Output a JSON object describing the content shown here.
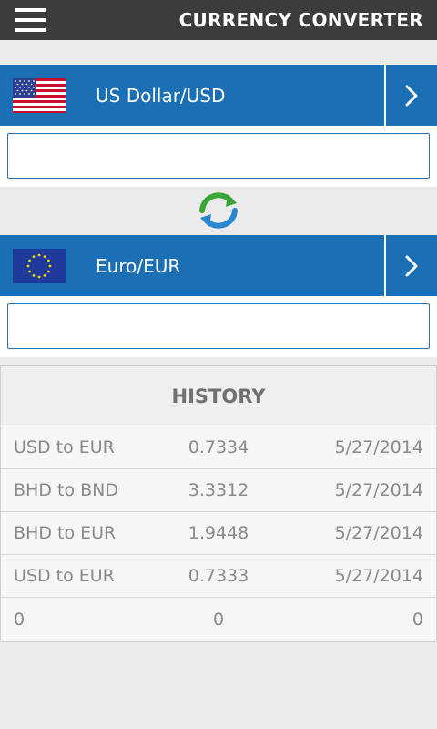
{
  "header": {
    "title": "CURRENCY CONVERTER",
    "menu_icon": "hamburger-menu-icon"
  },
  "from_currency": {
    "label": "US Dollar/USD",
    "flag": "us-flag-icon",
    "amount_value": "",
    "chevron_icon": "chevron-right-icon"
  },
  "swap": {
    "icon": "swap-arrows-icon"
  },
  "to_currency": {
    "label": "Euro/EUR",
    "flag": "eu-flag-icon",
    "amount_value": "",
    "chevron_icon": "chevron-right-icon"
  },
  "history": {
    "title": "HISTORY",
    "rows": [
      {
        "pair": "USD to EUR",
        "rate": "0.7334",
        "date": "5/27/2014"
      },
      {
        "pair": "BHD to BND",
        "rate": "3.3312",
        "date": "5/27/2014"
      },
      {
        "pair": "BHD to EUR",
        "rate": "1.9448",
        "date": "5/27/2014"
      },
      {
        "pair": "USD to EUR",
        "rate": "0.7333",
        "date": "5/27/2014"
      },
      {
        "pair": "0",
        "rate": "0",
        "date": "0"
      }
    ]
  },
  "colors": {
    "topbar": "#3c3c3c",
    "currency_bar": "#1b6fb5",
    "input_border": "#2a6fb0",
    "history_text": "#8a8a8a"
  }
}
